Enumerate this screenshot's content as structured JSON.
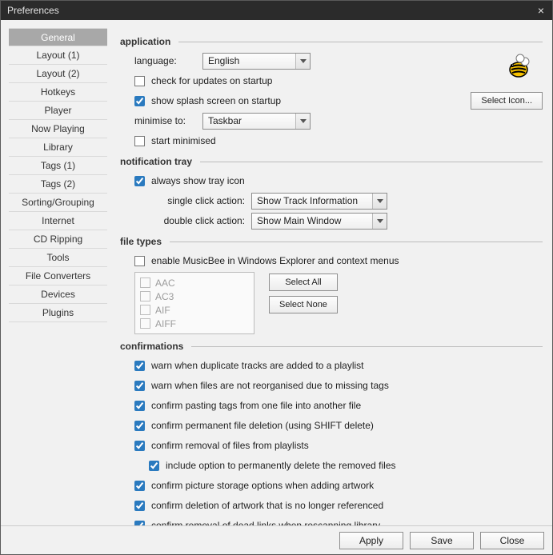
{
  "title": "Preferences",
  "sidebar": [
    "General",
    "Layout (1)",
    "Layout (2)",
    "Hotkeys",
    "Player",
    "Now Playing",
    "Library",
    "Tags (1)",
    "Tags (2)",
    "Sorting/Grouping",
    "Internet",
    "CD Ripping",
    "Tools",
    "File Converters",
    "Devices",
    "Plugins"
  ],
  "active_sidebar_index": 0,
  "application": {
    "heading": "application",
    "language_label": "language:",
    "language_value": "English",
    "check_updates": "check for updates on startup",
    "splash": "show splash screen on startup",
    "minimise_label": "minimise to:",
    "minimise_value": "Taskbar",
    "start_minimised": "start minimised",
    "select_icon_btn": "Select Icon..."
  },
  "tray": {
    "heading": "notification tray",
    "always_show": "always show tray icon",
    "single_label": "single click action:",
    "single_value": "Show Track Information",
    "double_label": "double click action:",
    "double_value": "Show Main Window"
  },
  "filetypes": {
    "heading": "file types",
    "enable": "enable MusicBee in Windows Explorer and context menus",
    "types": [
      "AAC",
      "AC3",
      "AIF",
      "AIFF"
    ],
    "select_all": "Select All",
    "select_none": "Select None"
  },
  "confirmations": {
    "heading": "confirmations",
    "items": [
      "warn when duplicate tracks are added to a playlist",
      "warn when files are not reorganised due to missing tags",
      "confirm pasting tags from one file into another file",
      "confirm permanent file deletion (using SHIFT delete)",
      "confirm removal of files from playlists"
    ],
    "sub_item": "include option to permanently delete the removed files",
    "items2": [
      "confirm picture storage options when adding artwork",
      "confirm deletion of artwork that is no longer referenced",
      "confirm removal of dead links when rescanning library"
    ]
  },
  "footer": {
    "apply": "Apply",
    "save": "Save",
    "close": "Close"
  }
}
